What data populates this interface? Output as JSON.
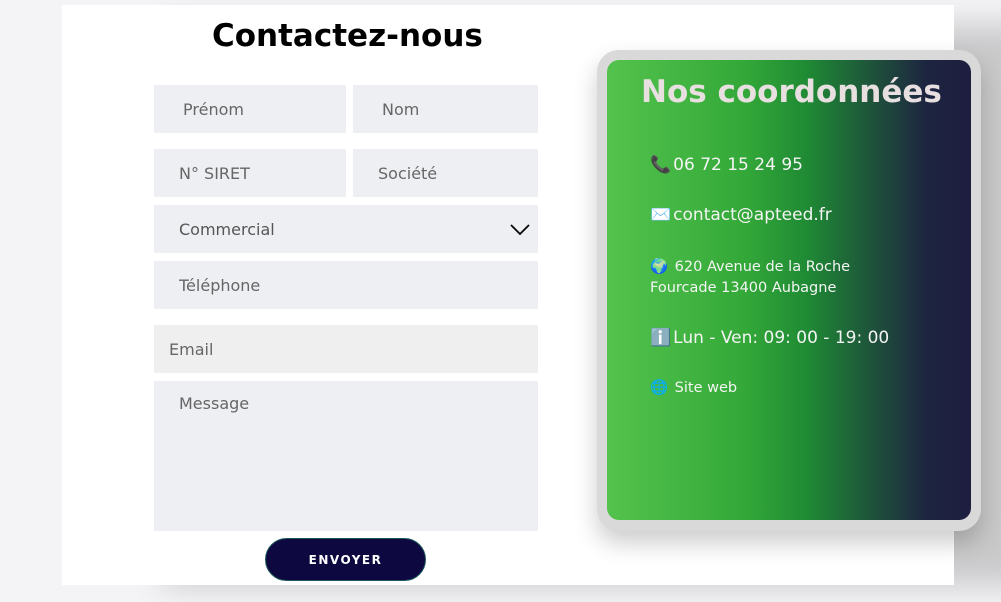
{
  "form": {
    "title": "Contactez-nous",
    "first_name_placeholder": "Prénom",
    "last_name_placeholder": "Nom",
    "siret_placeholder": "N° SIRET",
    "company_placeholder": "Société",
    "subject_selected": "Commercial",
    "phone_placeholder": "Téléphone",
    "email_placeholder": "Email",
    "message_placeholder": "Message",
    "submit_label": "ENVOYER"
  },
  "contact": {
    "title": "Nos coordonnées",
    "phone_icon": "📞",
    "phone": "06 72 15 24 95",
    "email_icon": "✉️",
    "email": "contact@apteed.fr",
    "address_icon": "🌍",
    "address_line1": "620 Avenue de la Roche",
    "address_line2": "Fourcade 13400 Aubagne",
    "hours_icon": "ℹ️",
    "hours": "Lun - Ven: 09: 00 - 19: 00",
    "website_icon": "🌐",
    "website": "Site web"
  },
  "colors": {
    "button_bg": "#0e0840",
    "gradient_start": "#54c34d",
    "gradient_end": "#1e1e40",
    "field_bg": "#eeeff2"
  }
}
